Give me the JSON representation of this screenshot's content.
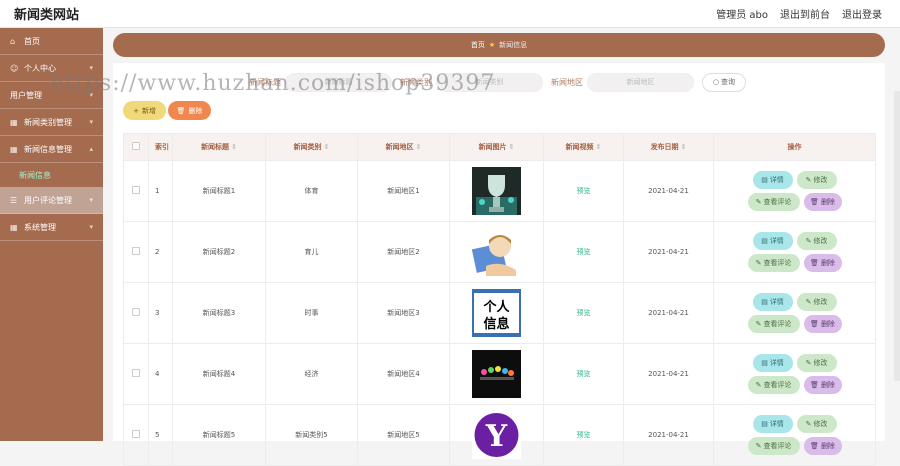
{
  "topbar": {
    "title": "新闻类网站",
    "admin": "管理员 abo",
    "exit_front": "退出到前台",
    "logout": "退出登录"
  },
  "sidebar": {
    "items": [
      {
        "label": "首页",
        "icon": "home-icon"
      },
      {
        "label": "个人中心",
        "icon": "user-icon"
      },
      {
        "label": "用户管理",
        "icon": "users-icon"
      },
      {
        "label": "新闻类别管理",
        "icon": "grid-icon"
      },
      {
        "label": "新闻信息管理",
        "icon": "grid-icon"
      },
      {
        "label": "新闻信息",
        "sub": true
      },
      {
        "label": "用户评论管理",
        "icon": "menu-icon"
      },
      {
        "label": "系统管理",
        "icon": "grid-icon"
      }
    ]
  },
  "breadcrumb": {
    "home": "首页",
    "current": "新闻信息"
  },
  "filters": {
    "title_label": "新闻标题",
    "title_placeholder": "新闻标题",
    "category_label": "新闻类别",
    "category_placeholder": "新闻类别",
    "region_label": "新闻地区",
    "region_placeholder": "新闻地区",
    "search_label": "查询"
  },
  "actions": {
    "add": "新增",
    "delete": "删除"
  },
  "table": {
    "headers": [
      "索引",
      "新闻标题",
      "新闻类别",
      "新闻地区",
      "新闻图片",
      "新闻视频",
      "发布日期",
      "操作"
    ],
    "rows": [
      {
        "index": "1",
        "title": "新闻标题1",
        "category": "体育",
        "region": "新闻地区1",
        "image": "trophy-image",
        "video": "预览",
        "date": "2021-04-21"
      },
      {
        "index": "2",
        "title": "新闻标题2",
        "category": "育儿",
        "region": "新闻地区2",
        "image": "child-image",
        "video": "预览",
        "date": "2021-04-21"
      },
      {
        "index": "3",
        "title": "新闻标题3",
        "category": "时事",
        "region": "新闻地区3",
        "image": "info-image",
        "video": "预览",
        "date": "2021-04-21"
      },
      {
        "index": "4",
        "title": "新闻标题4",
        "category": "经济",
        "region": "新闻地区4",
        "image": "concert-image",
        "video": "预览",
        "date": "2021-04-21"
      },
      {
        "index": "5",
        "title": "新闻标题5",
        "category": "新闻类别5",
        "region": "新闻地区5",
        "image": "yahoo-image",
        "video": "预览",
        "date": "2021-04-21"
      }
    ],
    "ops": {
      "detail": "详情",
      "edit": "修改",
      "comment": "查看评论",
      "delete": "删除"
    }
  },
  "watermark": "https://www.huzhan.com/ishop39397",
  "colors": {
    "sidebar": "#a46b4f",
    "accent": "#a35f41"
  }
}
